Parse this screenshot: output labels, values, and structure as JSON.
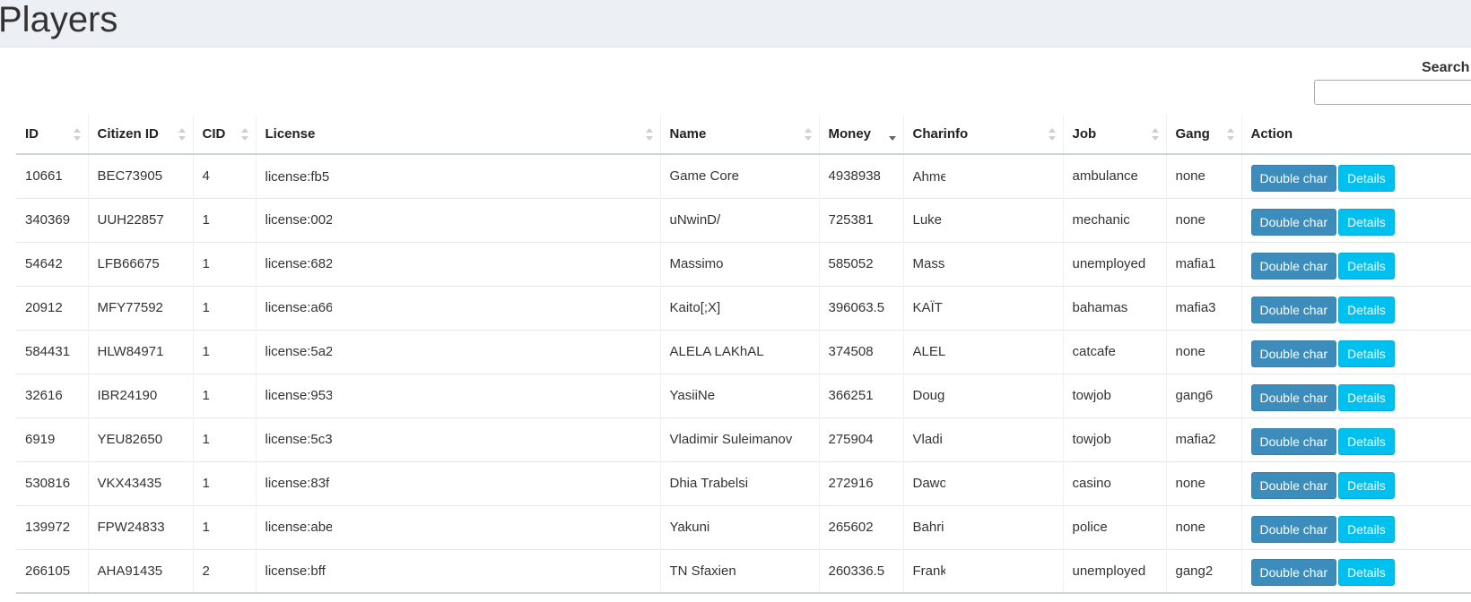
{
  "page": {
    "title": "Players"
  },
  "search": {
    "label": "Search",
    "value": "",
    "placeholder": ""
  },
  "table": {
    "columns": [
      "ID",
      "Citizen ID",
      "CID",
      "License",
      "Name",
      "Money",
      "Charinfo",
      "Job",
      "Gang",
      "Action"
    ],
    "sorted_column": "Money",
    "sort_direction": "descending",
    "rows": [
      {
        "id": "10661",
        "citizen_id": "BEC73905",
        "cid": "4",
        "license": "license:fb5",
        "name": "Game Core",
        "money": "4938938",
        "charinfo": "Ahme",
        "job": "ambulance",
        "gang": "none"
      },
      {
        "id": "340369",
        "citizen_id": "UUH22857",
        "cid": "1",
        "license": "license:002",
        "name": "uNwinD/",
        "money": "725381",
        "charinfo": "Luke",
        "job": "mechanic",
        "gang": "none"
      },
      {
        "id": "54642",
        "citizen_id": "LFB66675",
        "cid": "1",
        "license": "license:682",
        "name": "Massimo",
        "money": "585052",
        "charinfo": "Mass",
        "job": "unemployed",
        "gang": "mafia1"
      },
      {
        "id": "20912",
        "citizen_id": "MFY77592",
        "cid": "1",
        "license": "license:a66",
        "name": "Kaito[;X]",
        "money": "396063.5",
        "charinfo": "KAÏT",
        "job": "bahamas",
        "gang": "mafia3"
      },
      {
        "id": "584431",
        "citizen_id": "HLW84971",
        "cid": "1",
        "license": "license:5a2",
        "name": "ALELA LAKhAL",
        "money": "374508",
        "charinfo": "ALEL",
        "job": "catcafe",
        "gang": "none"
      },
      {
        "id": "32616",
        "citizen_id": "IBR24190",
        "cid": "1",
        "license": "license:953",
        "name": "YasiiNe",
        "money": "366251",
        "charinfo": "Doug",
        "job": "towjob",
        "gang": "gang6"
      },
      {
        "id": "6919",
        "citizen_id": "YEU82650",
        "cid": "1",
        "license": "license:5c3",
        "name": "Vladimir Suleimanov",
        "money": "275904",
        "charinfo": "Vladi",
        "job": "towjob",
        "gang": "mafia2"
      },
      {
        "id": "530816",
        "citizen_id": "VKX43435",
        "cid": "1",
        "license": "license:83f",
        "name": "Dhia Trabelsi",
        "money": "272916",
        "charinfo": "Dawo",
        "job": "casino",
        "gang": "none"
      },
      {
        "id": "139972",
        "citizen_id": "FPW24833",
        "cid": "1",
        "license": "license:abe",
        "name": "Yakuni",
        "money": "265602",
        "charinfo": "Bahri",
        "job": "police",
        "gang": "none"
      },
      {
        "id": "266105",
        "citizen_id": "AHA91435",
        "cid": "2",
        "license": "license:bff",
        "name": "TN Sfaxien",
        "money": "260336.5",
        "charinfo": "Frank",
        "job": "unemployed",
        "gang": "gang2"
      }
    ],
    "action_labels": {
      "double_char": "Double char",
      "details": "Details"
    }
  },
  "colors": {
    "header_bg": "#ecf0f5",
    "double_char_button": "#3c8dbc",
    "details_button": "#00c0ef"
  },
  "icons": {
    "sort": "sort-both-icon",
    "sort_active": "sort-desc-icon"
  }
}
